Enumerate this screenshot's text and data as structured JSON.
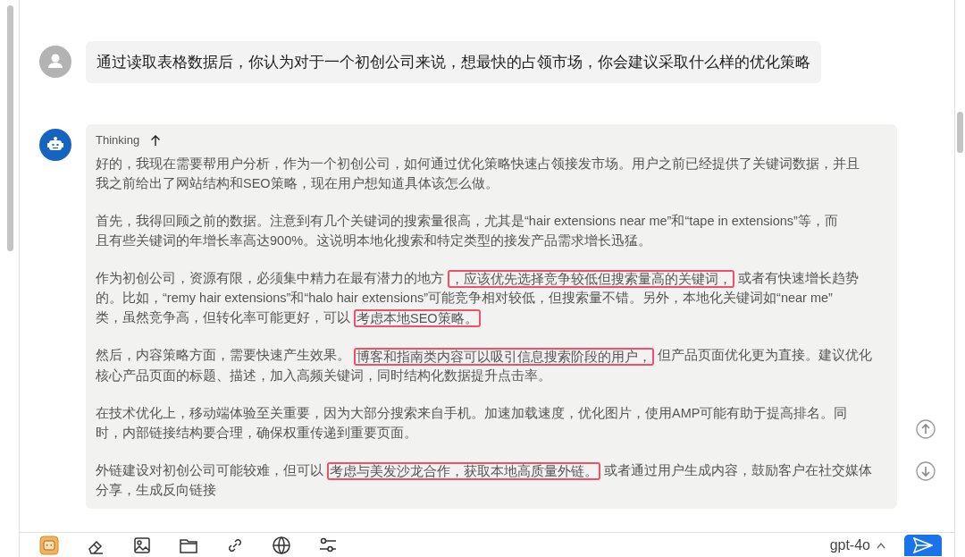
{
  "user_message": {
    "text": "通过读取表格数据后，你认为对于一个初创公司来说，想最快的占领市场，你会建议采取什么样的优化策略"
  },
  "assistant_message": {
    "thinking_label": "Thinking",
    "paragraphs": [
      {
        "lines": [
          [
            {
              "text": "好的，我现在需要帮用户分析，作为一个初创公司，如何通过优化策略快速占领接发市场。用户之前已经提供了关键词数据，并且",
              "highlighted": false
            }
          ],
          [
            {
              "text": "我之前给出了网站结构和SEO策略，现在用户想知道具体该怎么做。",
              "highlighted": false
            }
          ]
        ]
      },
      {
        "lines": [
          [
            {
              "text": "首先，我得回顾之前的数据。注意到有几个关键词的搜索量很高，尤其是“hair extensions near me”和“tape in extensions”等，而",
              "highlighted": false
            }
          ],
          [
            {
              "text": "且有些关键词的年增长率高达900%。这说明本地化搜索和特定类型的接发产品需求增长迅猛。",
              "highlighted": false
            }
          ]
        ]
      },
      {
        "lines": [
          [
            {
              "text": "作为初创公司，资源有限，必须集中精力在最有潜力的地方",
              "highlighted": false
            },
            {
              "text": "，应该优先选择竞争较低但搜索量高的关键词，",
              "highlighted": true
            },
            {
              "text": "或者有快速增长趋势",
              "highlighted": false
            }
          ],
          [
            {
              "text": "的。比如，“remy hair extensions”和“halo hair extensions”可能竞争相对较低，但搜索量不错。另外，本地化关键词如“near me”",
              "highlighted": false
            }
          ],
          [
            {
              "text": "类，虽然竞争高，但转化率可能更好，可以",
              "highlighted": false
            },
            {
              "text": "考虑本地SEO策略。",
              "highlighted": true
            }
          ]
        ]
      },
      {
        "lines": [
          [
            {
              "text": "然后，内容策略方面，需要快速产生效果。",
              "highlighted": false
            },
            {
              "text": "博客和指南类内容可以吸引信息搜索阶段的用户，",
              "highlighted": true
            },
            {
              "text": "但产品页面优化更为直接。建议优化",
              "highlighted": false
            }
          ],
          [
            {
              "text": "核心产品页面的标题、描述，加入高频关键词，同时结构化数据提升点击率。",
              "highlighted": false
            }
          ]
        ]
      },
      {
        "lines": [
          [
            {
              "text": "在技术优化上，移动端体验至关重要，因为大部分搜索来自手机。加速加载速度，优化图片，使用AMP可能有助于提高排名。同",
              "highlighted": false
            }
          ],
          [
            {
              "text": "时，内部链接结构要合理，确保权重传递到重要页面。",
              "highlighted": false
            }
          ]
        ]
      },
      {
        "lines": [
          [
            {
              "text": "外链建设对初创公司可能较难，但可以",
              "highlighted": false
            },
            {
              "text": "考虑与美发沙龙合作，获取本地高质量外链。",
              "highlighted": true
            },
            {
              "text": "或者通过用户生成内容，鼓励客户在社交媒体",
              "highlighted": false
            }
          ],
          [
            {
              "text": "分享，生成反向链接",
              "highlighted": false
            }
          ]
        ]
      }
    ]
  },
  "toolbar": {
    "model": "gpt-4o"
  }
}
